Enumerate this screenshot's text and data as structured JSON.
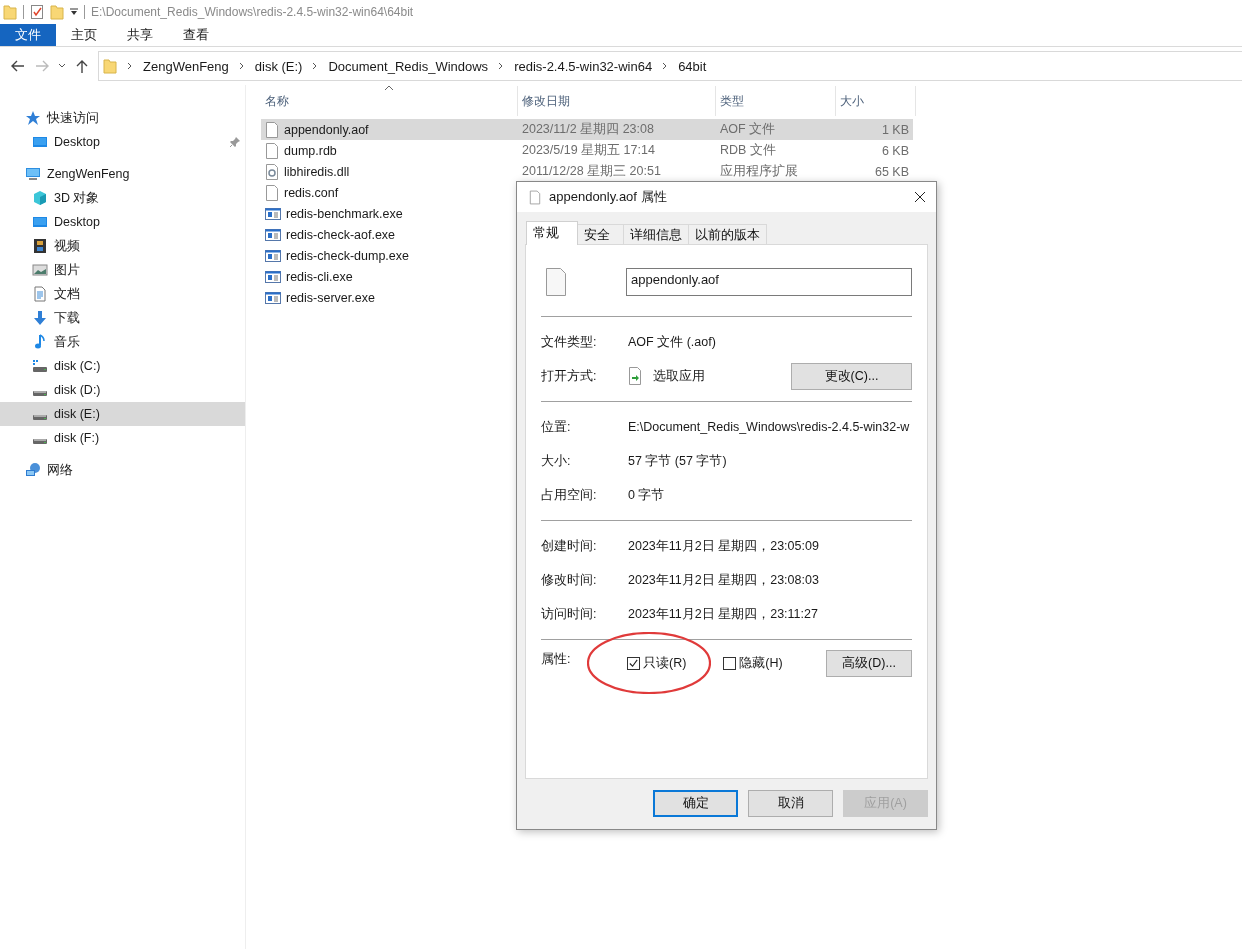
{
  "titlebar": {
    "path": "E:\\Document_Redis_Windows\\redis-2.4.5-win32-win64\\64bit"
  },
  "ribbon_tabs": [
    {
      "label": "文件",
      "selected": true
    },
    {
      "label": "主页",
      "selected": false
    },
    {
      "label": "共享",
      "selected": false
    },
    {
      "label": "查看",
      "selected": false
    }
  ],
  "navigation": {
    "forward_disabled": true
  },
  "breadcrumb": [
    "ZengWenFeng",
    "disk (E:)",
    "Document_Redis_Windows",
    "redis-2.4.5-win32-win64",
    "64bit"
  ],
  "sidebar": {
    "items": [
      {
        "label": "快速访问",
        "kind": "star",
        "selected": false,
        "children": [
          {
            "label": "Desktop",
            "kind": "desktop",
            "selected": false,
            "pinned": true
          }
        ]
      },
      {
        "label": "ZengWenFeng",
        "kind": "computer",
        "selected": false,
        "children": [
          {
            "label": "3D 对象",
            "kind": "cube",
            "selected": false
          },
          {
            "label": "Desktop",
            "kind": "desktop",
            "selected": false
          },
          {
            "label": "视频",
            "kind": "video",
            "selected": false
          },
          {
            "label": "图片",
            "kind": "image",
            "selected": false
          },
          {
            "label": "文档",
            "kind": "document",
            "selected": false
          },
          {
            "label": "下载",
            "kind": "download",
            "selected": false
          },
          {
            "label": "音乐",
            "kind": "music",
            "selected": false
          },
          {
            "label": "disk (C:)",
            "kind": "system-drive",
            "selected": false
          },
          {
            "label": "disk (D:)",
            "kind": "drive",
            "selected": false
          },
          {
            "label": "disk (E:)",
            "kind": "drive",
            "selected": true
          },
          {
            "label": "disk (F:)",
            "kind": "drive",
            "selected": false
          }
        ]
      },
      {
        "label": "网络",
        "kind": "network",
        "selected": false
      }
    ]
  },
  "columns": [
    "名称",
    "修改日期",
    "类型",
    "大小"
  ],
  "files": [
    {
      "name": "appendonly.aof",
      "kind": "file",
      "selected": true,
      "date": "2023/11/2 星期四 23:08",
      "type": "AOF 文件",
      "size": "1 KB"
    },
    {
      "name": "dump.rdb",
      "kind": "file",
      "selected": false,
      "date": "2023/5/19 星期五 17:14",
      "type": "RDB 文件",
      "size": "6 KB"
    },
    {
      "name": "libhiredis.dll",
      "kind": "library",
      "selected": false,
      "date": "2011/12/28 星期三 20:51",
      "type": "应用程序扩展",
      "size": "65 KB"
    },
    {
      "name": "redis.conf",
      "kind": "file",
      "selected": false
    },
    {
      "name": "redis-benchmark.exe",
      "kind": "program",
      "selected": false
    },
    {
      "name": "redis-check-aof.exe",
      "kind": "program",
      "selected": false
    },
    {
      "name": "redis-check-dump.exe",
      "kind": "program",
      "selected": false
    },
    {
      "name": "redis-cli.exe",
      "kind": "program",
      "selected": false
    },
    {
      "name": "redis-server.exe",
      "kind": "program",
      "selected": false
    }
  ],
  "dialog": {
    "title": "appendonly.aof 属性",
    "tabs": [
      {
        "label": "常规",
        "selected": true
      },
      {
        "label": "安全",
        "selected": false
      },
      {
        "label": "详细信息",
        "selected": false
      },
      {
        "label": "以前的版本",
        "selected": false
      }
    ],
    "name_field": "appendonly.aof",
    "sections": [
      [
        {
          "kind": "text",
          "label": "文件类型:",
          "value": "AOF 文件 (.aof)"
        },
        {
          "kind": "app",
          "label": "打开方式:",
          "value": "选取应用",
          "button": "更改(C)..."
        }
      ],
      [
        {
          "kind": "text",
          "label": "位置:",
          "value": "E:\\Document_Redis_Windows\\redis-2.4.5-win32-w"
        },
        {
          "kind": "text",
          "label": "大小:",
          "value": "57 字节 (57 字节)"
        },
        {
          "kind": "text",
          "label": "占用空间:",
          "value": "0 字节"
        }
      ],
      [
        {
          "kind": "text",
          "label": "创建时间:",
          "value": "2023年11月2日 星期四，23:05:09"
        },
        {
          "kind": "text",
          "label": "修改时间:",
          "value": "2023年11月2日 星期四，23:08:03"
        },
        {
          "kind": "text",
          "label": "访问时间:",
          "value": "2023年11月2日 星期四，23:11:27"
        }
      ]
    ],
    "attributes_label": "属性:",
    "attributes": [
      {
        "label": "只读(R)",
        "checked": true,
        "circled": true
      },
      {
        "label": "隐藏(H)",
        "checked": false,
        "circled": false
      }
    ],
    "advanced_button": "高级(D)...",
    "buttons": [
      {
        "label": "确定",
        "default": true,
        "disabled": false
      },
      {
        "label": "取消",
        "default": false,
        "disabled": false
      },
      {
        "label": "应用(A)",
        "default": false,
        "disabled": true
      }
    ]
  }
}
